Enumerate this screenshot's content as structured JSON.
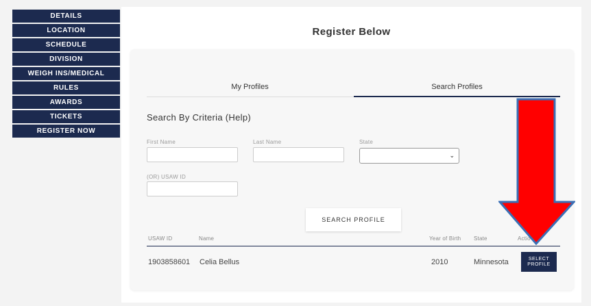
{
  "sidebar": {
    "items": [
      {
        "label": "DETAILS"
      },
      {
        "label": "LOCATION"
      },
      {
        "label": "SCHEDULE"
      },
      {
        "label": "DIVISION"
      },
      {
        "label": "WEIGH INS/MEDICAL"
      },
      {
        "label": "RULES"
      },
      {
        "label": "AWARDS"
      },
      {
        "label": "TICKETS"
      },
      {
        "label": "REGISTER NOW"
      }
    ]
  },
  "main": {
    "title": "Register Below",
    "tabs": [
      {
        "label": "My Profiles",
        "active": false
      },
      {
        "label": "Search Profiles",
        "active": true
      }
    ],
    "search": {
      "heading": "Search By Criteria (Help)",
      "first_name_label": "First Name",
      "first_name_value": "",
      "last_name_label": "Last Name",
      "last_name_value": "",
      "state_label": "State",
      "state_value": "",
      "usaw_id_label": "(OR) USAW ID",
      "usaw_id_value": "",
      "button_label": "SEARCH PROFILE"
    },
    "results": {
      "columns": [
        "USAW ID",
        "Name",
        "Year of Birth",
        "State",
        "Actio"
      ],
      "rows": [
        {
          "usaw_id": "1903858601",
          "name": "Celia Bellus",
          "year_of_birth": "2010",
          "state": "Minnesota",
          "action_label_line1": "SELECT",
          "action_label_line2": "PROFILE"
        }
      ]
    }
  },
  "annotation": {
    "arrow_color": "#ff0000",
    "arrow_outline": "#3a6fb5"
  },
  "colors": {
    "navy": "#1c2a4f",
    "panel": "#ffffff",
    "card": "#f7f7f7",
    "background": "#f3f3f3"
  }
}
